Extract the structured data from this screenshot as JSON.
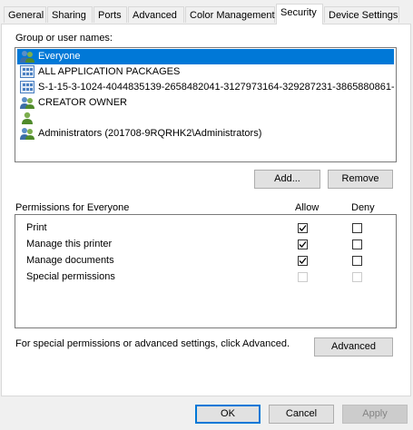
{
  "tabs": [
    {
      "label": "General"
    },
    {
      "label": "Sharing"
    },
    {
      "label": "Ports"
    },
    {
      "label": "Advanced"
    },
    {
      "label": "Color Management"
    },
    {
      "label": "Security"
    },
    {
      "label": "Device Settings"
    }
  ],
  "group_label": "Group or user names:",
  "users": [
    {
      "name": "Everyone",
      "icon": "users-group-icon"
    },
    {
      "name": "ALL APPLICATION PACKAGES",
      "icon": "app-packages-icon"
    },
    {
      "name": "S-1-15-3-1024-4044835139-2658482041-3127973164-329287231-3865880861-...",
      "icon": "app-packages-icon"
    },
    {
      "name": "CREATOR OWNER",
      "icon": "users-group-icon"
    },
    {
      "name": "",
      "icon": "user-icon"
    },
    {
      "name": "Administrators (201708-9RQRHK2\\Administrators)",
      "icon": "users-group-icon"
    }
  ],
  "buttons": {
    "add": "Add...",
    "remove": "Remove",
    "advanced": "Advanced",
    "ok": "OK",
    "cancel": "Cancel",
    "apply": "Apply"
  },
  "permissions": {
    "title": "Permissions for Everyone",
    "allow_header": "Allow",
    "deny_header": "Deny",
    "rows": [
      {
        "name": "Print",
        "allow": true,
        "deny": false,
        "enabled": true
      },
      {
        "name": "Manage this printer",
        "allow": true,
        "deny": false,
        "enabled": true
      },
      {
        "name": "Manage documents",
        "allow": true,
        "deny": false,
        "enabled": true
      },
      {
        "name": "Special permissions",
        "allow": false,
        "deny": false,
        "enabled": false
      }
    ]
  },
  "advanced_note": "For special permissions or advanced settings, click Advanced.",
  "colors": {
    "selection": "#0078d7",
    "default_button_border": "#0078d7"
  }
}
